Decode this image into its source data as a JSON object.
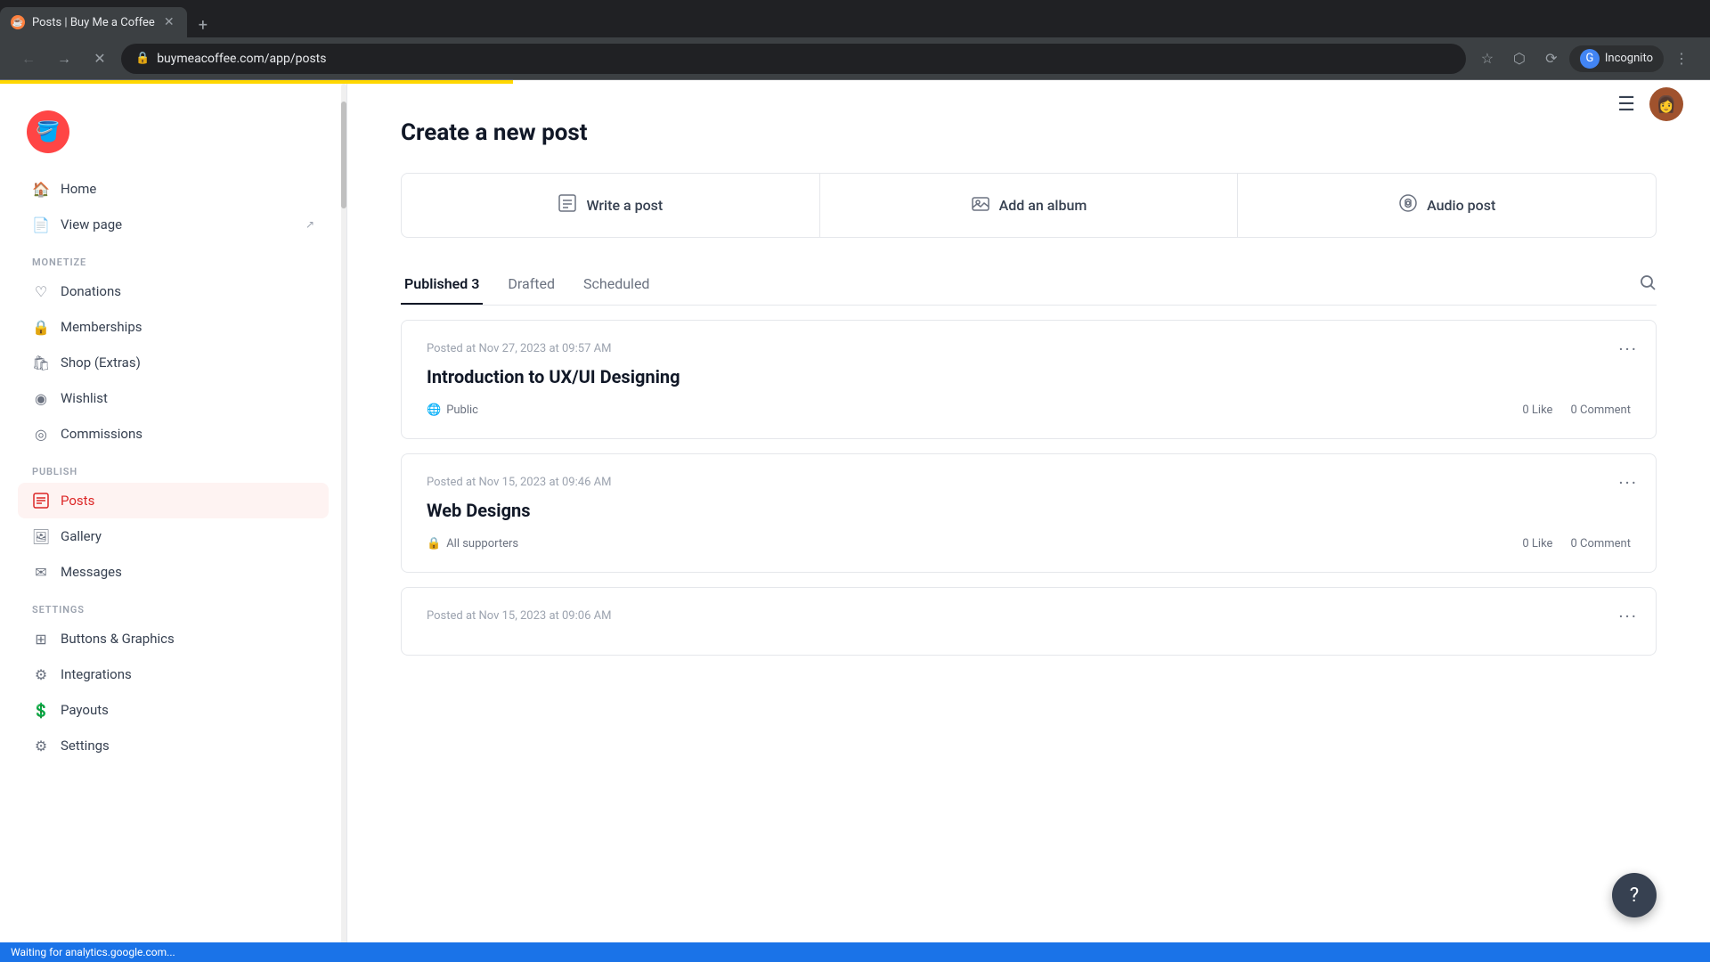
{
  "browser": {
    "tab_title": "Posts | Buy Me a Coffee",
    "url": "buymeacoffee.com/app/posts",
    "favicon": "☕",
    "incognito_label": "Incognito"
  },
  "header": {
    "hamburger": "☰"
  },
  "sidebar": {
    "logo_emoji": "🪣",
    "nav_groups": [
      {
        "items": [
          {
            "label": "Home",
            "icon": "🏠",
            "active": false
          },
          {
            "label": "View page",
            "icon": "📄",
            "active": false,
            "external": true
          }
        ]
      },
      {
        "section_label": "MONETIZE",
        "items": [
          {
            "label": "Donations",
            "icon": "♡",
            "active": false
          },
          {
            "label": "Memberships",
            "icon": "🔒",
            "active": false
          },
          {
            "label": "Shop (Extras)",
            "icon": "🛍",
            "active": false
          },
          {
            "label": "Wishlist",
            "icon": "⊙",
            "active": false
          },
          {
            "label": "Commissions",
            "icon": "◎",
            "active": false
          }
        ]
      },
      {
        "section_label": "PUBLISH",
        "items": [
          {
            "label": "Posts",
            "icon": "📝",
            "active": true
          },
          {
            "label": "Gallery",
            "icon": "🖼",
            "active": false
          },
          {
            "label": "Messages",
            "icon": "✉",
            "active": false
          }
        ]
      },
      {
        "section_label": "SETTINGS",
        "items": [
          {
            "label": "Buttons & Graphics",
            "icon": "⊞",
            "active": false
          },
          {
            "label": "Integrations",
            "icon": "⚙",
            "active": false
          },
          {
            "label": "Payouts",
            "icon": "💲",
            "active": false
          },
          {
            "label": "Settings",
            "icon": "⚙",
            "active": false
          }
        ]
      }
    ]
  },
  "main": {
    "page_title": "Create a new post",
    "post_type_cards": [
      {
        "icon": "📝",
        "label": "Write a post"
      },
      {
        "icon": "🖼",
        "label": "Add an album"
      },
      {
        "icon": "🎧",
        "label": "Audio post"
      }
    ],
    "tabs": [
      {
        "label": "Published 3",
        "active": true
      },
      {
        "label": "Drafted",
        "active": false
      },
      {
        "label": "Scheduled",
        "active": false
      }
    ],
    "posts": [
      {
        "meta": "Posted at Nov 27, 2023 at 09:57 AM",
        "title": "Introduction to UX/UI Designing",
        "visibility": "Public",
        "visibility_icon": "🌐",
        "likes": "0 Like",
        "comments": "0 Comment"
      },
      {
        "meta": "Posted at Nov 15, 2023 at 09:46 AM",
        "title": "Web Designs",
        "visibility": "All supporters",
        "visibility_icon": "🔒",
        "likes": "0 Like",
        "comments": "0 Comment"
      },
      {
        "meta": "Posted at Nov 15, 2023 at 09:06 AM",
        "title": "",
        "visibility": "",
        "visibility_icon": "",
        "likes": "",
        "comments": ""
      }
    ]
  },
  "status_bar": {
    "text": "Waiting for analytics.google.com..."
  }
}
